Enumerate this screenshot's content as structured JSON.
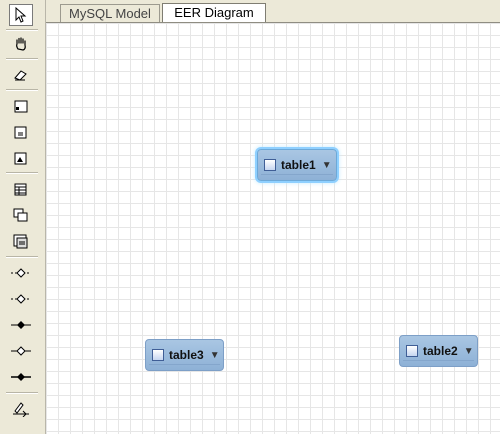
{
  "tabs": [
    {
      "label": "MySQL Model"
    },
    {
      "label": "EER Diagram"
    }
  ],
  "toolbar": {
    "tools": [
      {
        "name": "select-tool",
        "icon": "arrow-cursor-icon"
      },
      {
        "name": "hand-tool",
        "icon": "hand-icon"
      },
      {
        "name": "eraser-tool",
        "icon": "eraser-icon"
      },
      {
        "name": "layer-tool",
        "icon": "layer-icon"
      },
      {
        "name": "note-tool",
        "icon": "note-icon"
      },
      {
        "name": "image-tool",
        "icon": "image-icon"
      },
      {
        "name": "table-tool",
        "icon": "table-icon"
      },
      {
        "name": "view-tool",
        "icon": "view-icon"
      },
      {
        "name": "routine-group-tool",
        "icon": "routine-group-icon"
      },
      {
        "name": "relationship-1-1-nonidentifying",
        "icon": "relation-1-1-dashed-icon"
      },
      {
        "name": "relationship-1-n-nonidentifying",
        "icon": "relation-1-n-dashed-icon"
      },
      {
        "name": "relationship-1-1-identifying",
        "icon": "relation-1-1-icon"
      },
      {
        "name": "relationship-1-n-identifying",
        "icon": "relation-1-n-icon"
      },
      {
        "name": "relationship-n-m",
        "icon": "relation-n-m-icon"
      },
      {
        "name": "relationship-existing-columns",
        "icon": "relation-pick-icon"
      }
    ]
  },
  "canvas": {
    "tables": [
      {
        "name": "table1",
        "selected": true
      },
      {
        "name": "table3",
        "selected": false
      },
      {
        "name": "table2",
        "selected": false
      }
    ]
  }
}
